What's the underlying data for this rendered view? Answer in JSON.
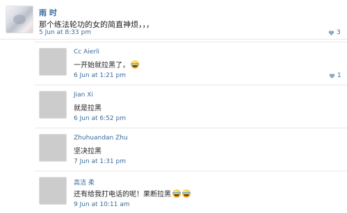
{
  "post": {
    "author": "雨 时",
    "text": "那个练法轮功的女的简直神烦，，，",
    "time": "5 Jun at 8:33 pm",
    "likes": "3"
  },
  "replies": [
    {
      "author": "Cc Aierli",
      "text": "一开始就拉黑了，",
      "emoji": true,
      "time": "6 Jun at 1:21 pm",
      "likes": "1",
      "avatar_icon": "user-avatar-icon"
    },
    {
      "author": "Jian Xi",
      "text": "就是拉黑",
      "emoji": false,
      "time": "6 Jun at 6:52 pm",
      "likes": "",
      "avatar_icon": "user-avatar-icon"
    },
    {
      "author": "Zhuhuandan Zhu",
      "text": "坚决拉黑",
      "emoji": false,
      "time": "7 Jun at 1:31 pm",
      "likes": "",
      "avatar_icon": "user-avatar-icon"
    },
    {
      "author": "高洁 柔",
      "text": "还有给我打电话的呢！果断拉黑",
      "emoji": true,
      "emoji_count": 2,
      "time": "9 Jun at 10:11 am",
      "likes": "",
      "avatar_icon": "user-avatar-icon"
    }
  ],
  "colors": {
    "link": "#3b6a9c",
    "divider": "#e6e6e6"
  },
  "icons": {
    "like": "heart-icon",
    "emoji": "laugh-crying-emoji-icon"
  }
}
